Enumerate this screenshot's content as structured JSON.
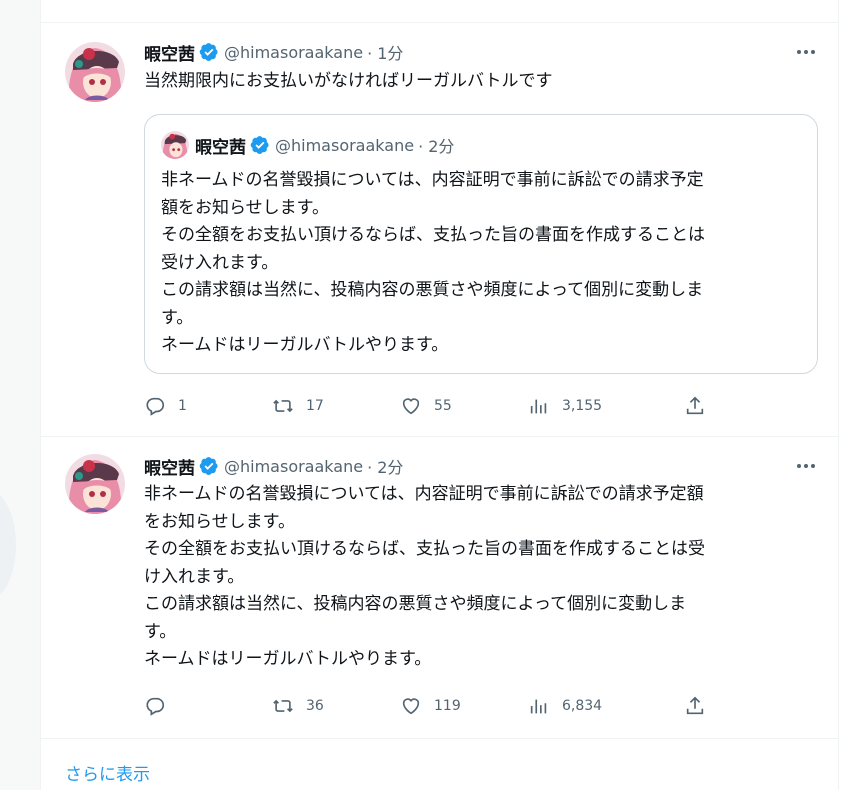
{
  "tweets": [
    {
      "author": "暇空茜",
      "handle": "@himasoraakane",
      "time": "· 1分",
      "text": "当然期限内にお支払いがなければリーガルバトルです",
      "quote": {
        "author": "暇空茜",
        "handle": "@himasoraakane",
        "time": "· 2分",
        "text": "非ネームドの名誉毀損については、内容証明で事前に訴訟での請求予定\n額をお知らせします。\nその全額をお支払い頂けるならば、支払った旨の書面を作成することは\n受け入れます。\nこの請求額は当然に、投稿内容の悪質さや頻度によって個別に変動しま\nす。\nネームドはリーガルバトルやります。"
      },
      "replies": "1",
      "retweets": "17",
      "likes": "55",
      "views": "3,155"
    },
    {
      "author": "暇空茜",
      "handle": "@himasoraakane",
      "time": "· 2分",
      "text": "非ネームドの名誉毀損については、内容証明で事前に訴訟での請求予定額\nをお知らせします。\nその全額をお支払い頂けるならば、支払った旨の書面を作成することは受\nけ入れます。\nこの請求額は当然に、投稿内容の悪質さや頻度によって個別に変動しま\nす。\nネームドはリーガルバトルやります。",
      "replies": "",
      "retweets": "36",
      "likes": "119",
      "views": "6,834"
    }
  ],
  "show_more": "さらに表示",
  "colors": {
    "accent": "#1d9bf0",
    "muted": "#536471",
    "border": "#eff3f4"
  },
  "icons": [
    "verified-badge-icon",
    "more-icon",
    "reply-icon",
    "retweet-icon",
    "like-icon",
    "views-icon",
    "share-icon"
  ]
}
